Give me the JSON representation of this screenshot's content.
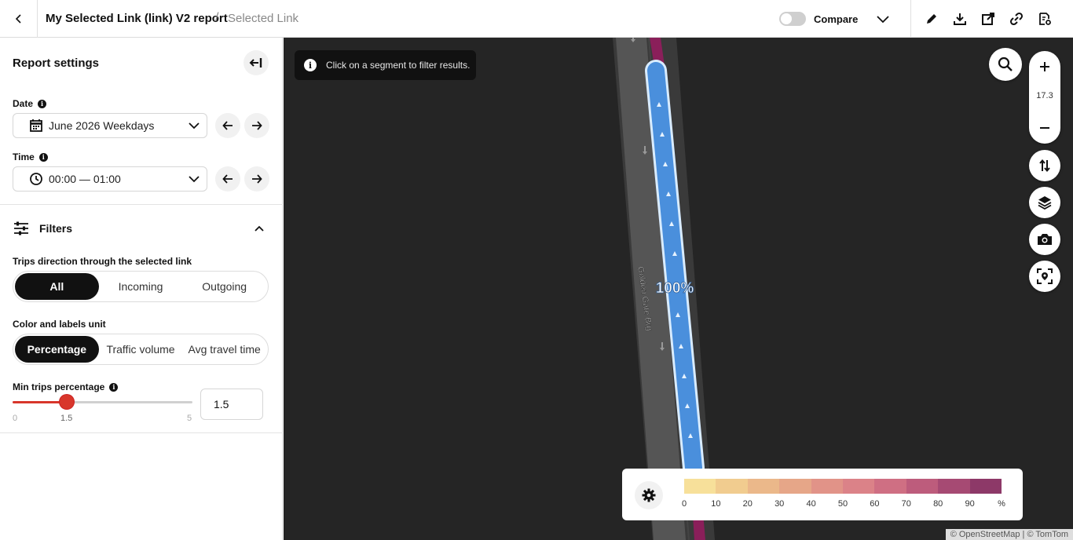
{
  "header": {
    "back_icon": "chevron-left-icon",
    "title": "My Selected Link (link) V2 report",
    "separator": "/",
    "breadcrumb": "Selected Link",
    "compare_label": "Compare",
    "compare_on": false,
    "toolbar_icons": [
      "edit-icon",
      "download-icon",
      "share-icon",
      "link-icon",
      "report-settings-icon"
    ]
  },
  "sidebar": {
    "title": "Report settings",
    "date": {
      "label": "Date",
      "value": "June 2026 Weekdays"
    },
    "time": {
      "label": "Time",
      "value": "00:00 — 01:00"
    },
    "filters": {
      "title": "Filters",
      "direction": {
        "label": "Trips direction through the selected link",
        "options": [
          "All",
          "Incoming",
          "Outgoing"
        ],
        "selected": "All"
      },
      "unit": {
        "label": "Color and labels unit",
        "options": [
          "Percentage",
          "Traffic volume",
          "Avg travel time"
        ],
        "selected": "Percentage"
      },
      "min_trips": {
        "label": "Min trips percentage",
        "min": "0",
        "max": "5",
        "value": "1.5",
        "fraction": 0.3
      }
    }
  },
  "map": {
    "tooltip": "Click on a segment to filter results.",
    "zoom_level": "17.3",
    "road_label": "Golden Gate Brg",
    "segment_label": "100%",
    "legend": {
      "values": [
        "0",
        "10",
        "20",
        "30",
        "40",
        "50",
        "60",
        "70",
        "80",
        "90",
        "%"
      ],
      "colors": [
        "#f7e09a",
        "#f1cc8f",
        "#ebb88a",
        "#e6a688",
        "#e19388",
        "#db8288",
        "#cf6f83",
        "#bd5c7c",
        "#a64a73",
        "#8d3968",
        "#722a5e"
      ]
    },
    "attribution": "© OpenStreetMap | © TomTom"
  }
}
